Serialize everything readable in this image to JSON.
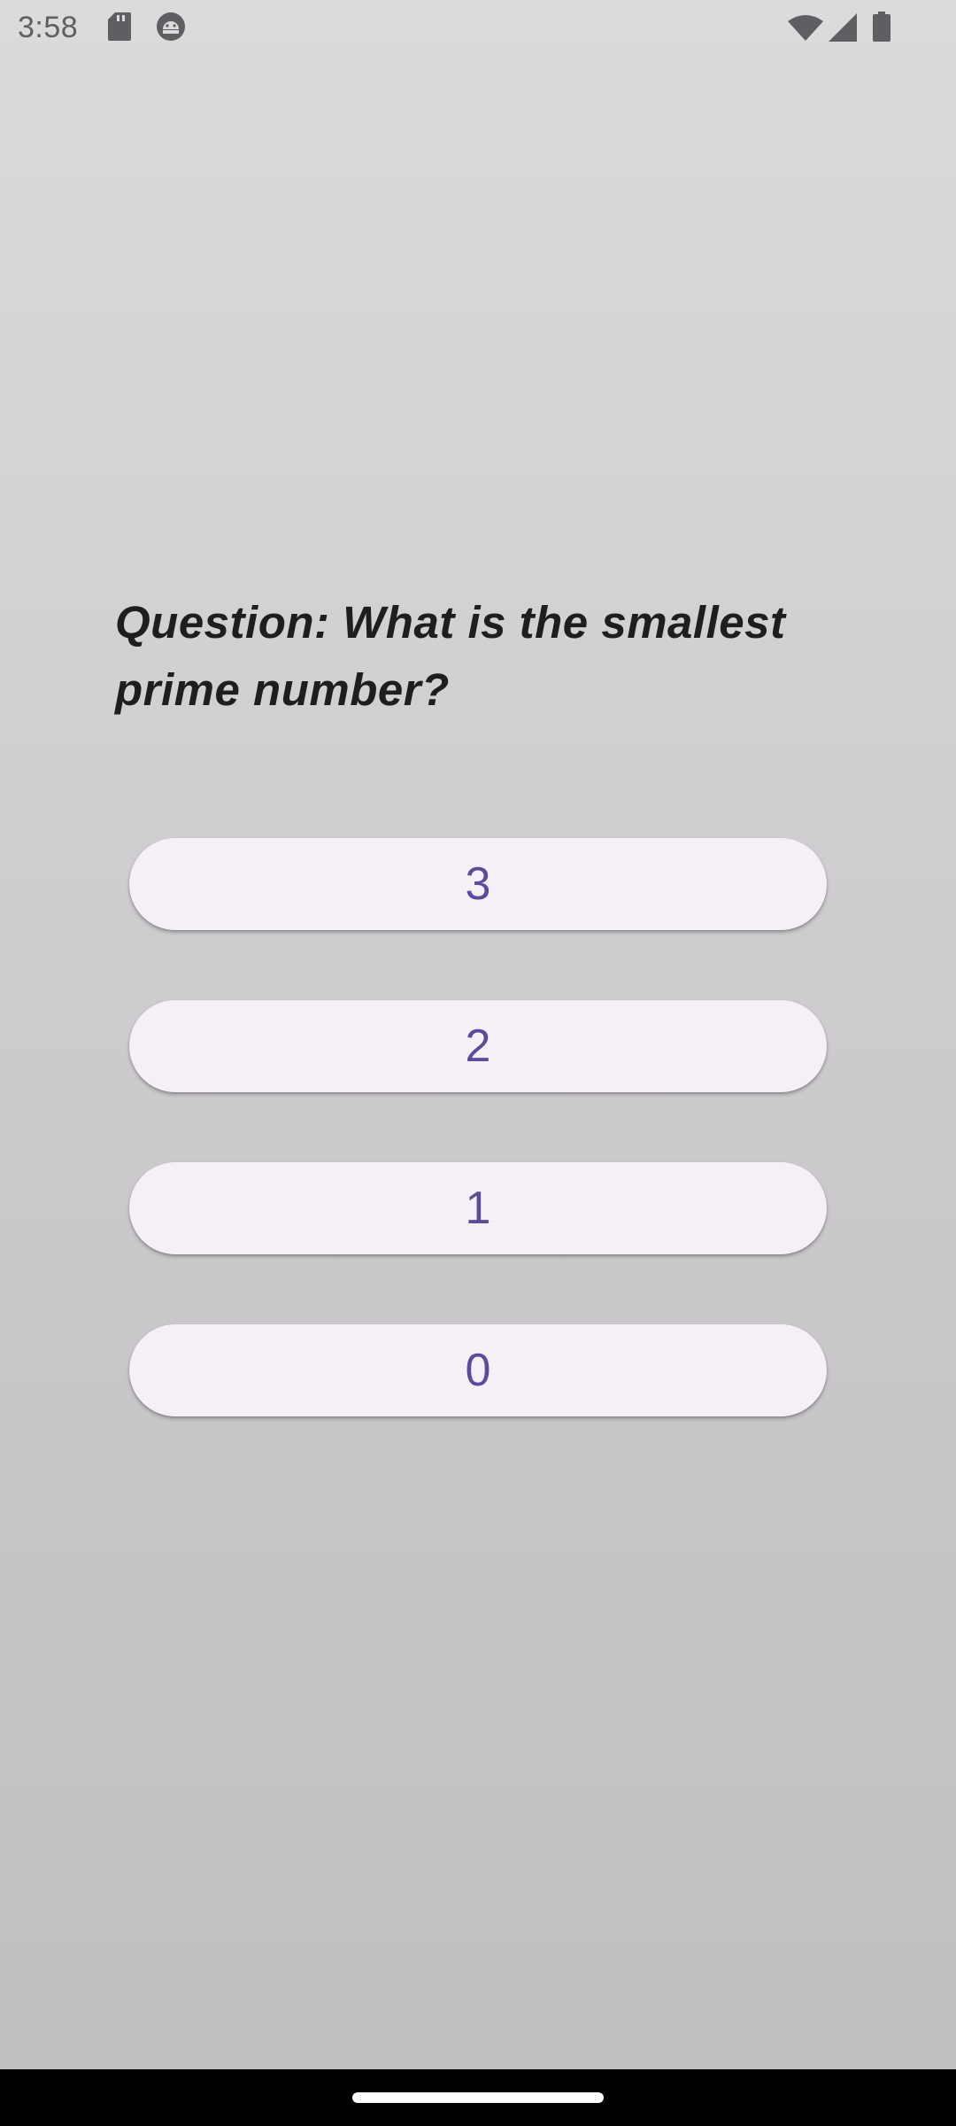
{
  "status_bar": {
    "time": "3:58",
    "icons": [
      "sd-card-icon",
      "android-debug-icon",
      "wifi-icon",
      "cellular-signal-icon",
      "battery-icon"
    ]
  },
  "quiz": {
    "question": "Question: What is the smallest prime number?",
    "answers": [
      {
        "label": "3"
      },
      {
        "label": "2"
      },
      {
        "label": "1"
      },
      {
        "label": "0"
      }
    ]
  },
  "colors": {
    "answer_text": "#5e4a9b",
    "answer_background": "#f5f0f7",
    "question_text": "#1f1d20"
  }
}
